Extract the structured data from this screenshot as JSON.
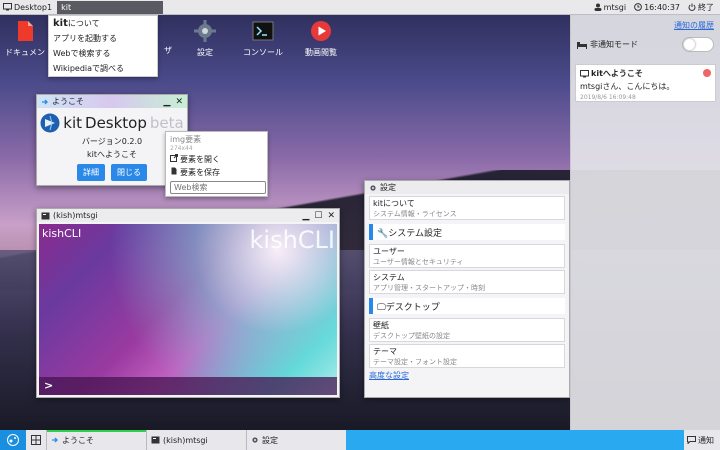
{
  "topbar": {
    "desktop_label": "Desktop1",
    "search_value": "kit",
    "user": "mtsgi",
    "time": "16:40:37",
    "shutdown_label": "終了"
  },
  "search_dropdown": {
    "items": [
      {
        "bold": "kit",
        "rest": "について"
      },
      {
        "bold": "",
        "rest": "アプリを起動する"
      },
      {
        "bold": "",
        "rest": "Webで検索する"
      },
      {
        "bold": "",
        "rest": "Wikipediaで調べる"
      }
    ]
  },
  "desktop_icons": {
    "documents": "ドキュメン",
    "hidden_partial": "ザ",
    "settings": "設定",
    "console": "コンソール",
    "video": "動画閲覧"
  },
  "welcome_window": {
    "title": "ようこそ",
    "logo_kit": "kit",
    "logo_desktop": "Desktop",
    "logo_beta": "beta",
    "version": "バージョン0.2.0",
    "greeting": "kitへようこそ",
    "details_button": "詳細",
    "close_button": "閉じる"
  },
  "context_menu": {
    "element_label": "img要素",
    "size": "274x44",
    "open_element": "要素を開く",
    "save_element": "要素を保存",
    "web_search_placeholder": "Web検索"
  },
  "kish_window": {
    "title": "(kish)mtsgi",
    "small_label": "kishCLI",
    "big_label": "kishCLI",
    "prompt": ">"
  },
  "settings_window": {
    "title": "設定",
    "items_top": [
      {
        "title": "kitについて",
        "sub": "システム情報・ライセンス"
      }
    ],
    "section_system": "システム設定",
    "items_system": [
      {
        "title": "ユーザー",
        "sub": "ユーザー情報とセキュリティ"
      },
      {
        "title": "システム",
        "sub": "アプリ管理・スタートアップ・時刻"
      }
    ],
    "section_desktop": "デスクトップ",
    "items_desktop": [
      {
        "title": "壁紙",
        "sub": "デスクトップ壁紙の設定"
      },
      {
        "title": "テーマ",
        "sub": "テーマ設定・フォント設定"
      }
    ],
    "advanced_link": "高度な設定"
  },
  "notification_panel": {
    "history_link": "通知の履歴",
    "dnd_label": "非通知モード",
    "card": {
      "title": "kitへようこそ",
      "body": "mtsgiさん、こんにちは。",
      "date": "2019/8/6 16:09:48"
    }
  },
  "taskbar": {
    "tasks": [
      {
        "label": "ようこそ"
      },
      {
        "label": "(kish)mtsgi"
      },
      {
        "label": "設定"
      }
    ],
    "notify_label": "通知"
  },
  "colors": {
    "accent": "#2a89e8",
    "taskbar": "#29a9f0",
    "notify_dot": "#ee6666"
  }
}
